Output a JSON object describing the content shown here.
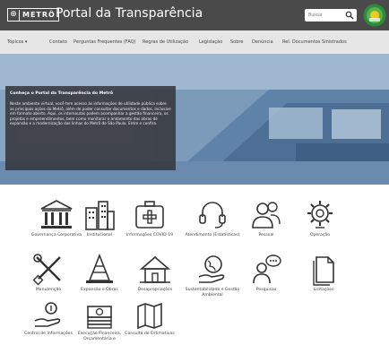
{
  "header": {
    "logo_text": "METRÔ",
    "title": "Portal da Transparência",
    "search_placeholder": "Buscar"
  },
  "nav": {
    "items": [
      "Tópicos ▾",
      "Contato",
      "Perguntas Frequentes (FAQ)",
      "Regras de Utilização",
      "Legislação",
      "Sobre",
      "Denúncia",
      "Rel. Documentos Sinistrados"
    ]
  },
  "hero": {
    "title": "Conheça o Portal da Transparência do Metrô",
    "text": "Neste ambiente virtual, você tem acesso às informações de utilidade pública sobre as principais ações do Metrô, além de poder consultar documentos e dados, inclusive em formato aberto. Aqui, os internautas podem acompanhar a gestão financeira, os projetos e empreendimentos, bem como monitorar o andamento das obras de expansão e a modernização das linhas do Metrô de São Paulo. Entre e confira."
  },
  "tiles": [
    {
      "label": "Governança Corporativa",
      "icon": "bank-icon"
    },
    {
      "label": "Institucional",
      "icon": "buildings-icon"
    },
    {
      "label": "Informações COVID-19",
      "icon": "medical-kit-icon"
    },
    {
      "label": "Atendimento (Estatísticas)",
      "icon": "headset-icon"
    },
    {
      "label": "Pessoal",
      "icon": "people-icon"
    },
    {
      "label": "Operação",
      "icon": "gear-icon"
    },
    {
      "label": "Manutenção",
      "icon": "tools-icon"
    },
    {
      "label": "Expansão e Obras",
      "icon": "traffic-cone-icon"
    },
    {
      "label": "Desapropriações",
      "icon": "house-icon"
    },
    {
      "label": "Sustentabilidade e Gestão Ambiental",
      "icon": "globe-hand-icon"
    },
    {
      "label": "Pesquisas",
      "icon": "survey-person-icon"
    },
    {
      "label": "Licitações",
      "icon": "document-icon"
    },
    {
      "label": "Central de Informações",
      "icon": "hand-coin-icon"
    },
    {
      "label": "Execução Financeira, Orçamentária e",
      "icon": "money-stack-icon"
    },
    {
      "label": "Consulta de Estimativas",
      "icon": "map-icon"
    }
  ]
}
